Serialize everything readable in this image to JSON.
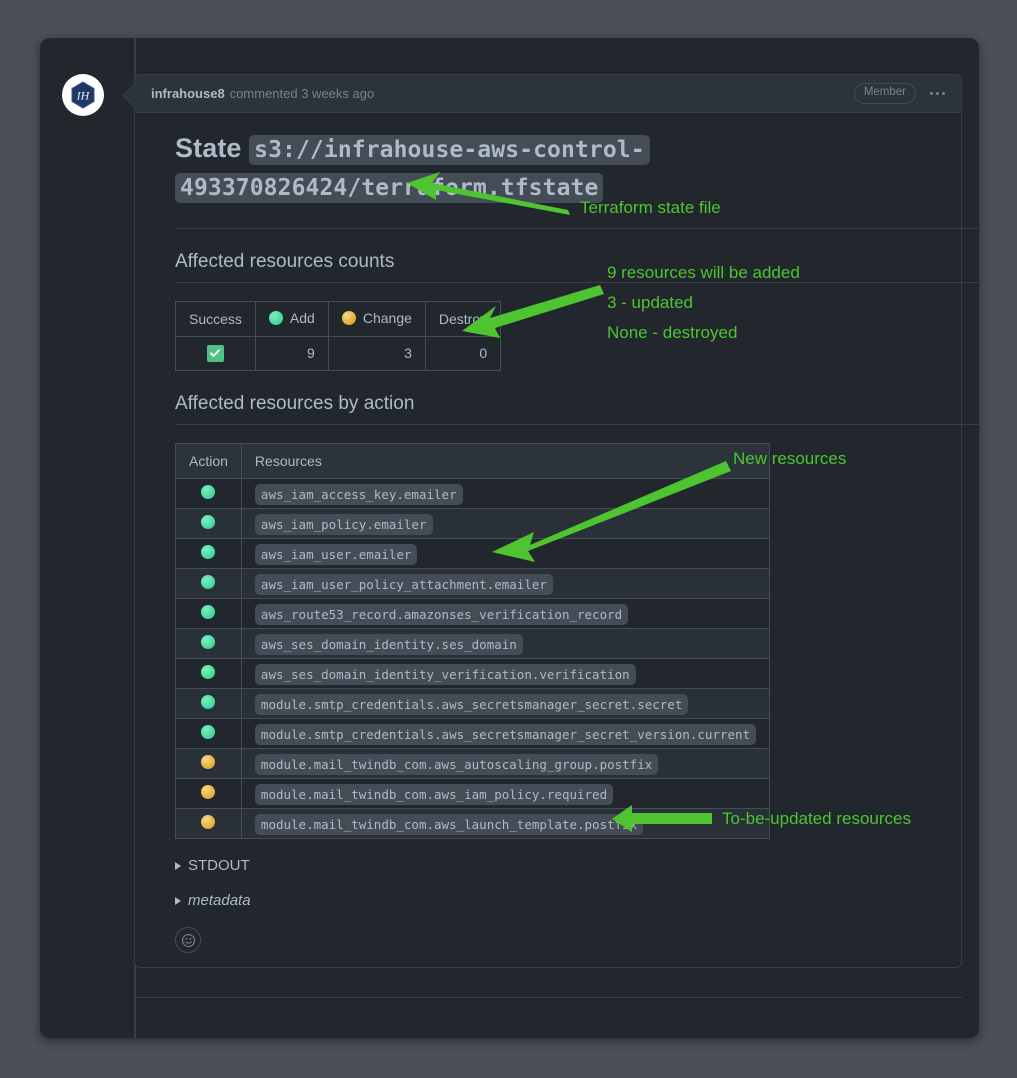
{
  "comment": {
    "author": "infrahouse8",
    "meta": "commented 3 weeks ago",
    "badge": "Member",
    "avatar_initials": "IH"
  },
  "state": {
    "label": "State",
    "path": "s3://infrahouse-aws-control-493370826424/terraform.tfstate"
  },
  "sections": {
    "counts_title": "Affected resources counts",
    "by_action_title": "Affected resources by action"
  },
  "counts_table": {
    "headers": [
      "Success",
      "Add",
      "Change",
      "Destroy"
    ],
    "row": {
      "success": true,
      "add": "9",
      "change": "3",
      "destroy": "0"
    }
  },
  "resources_table": {
    "headers": [
      "Action",
      "Resources"
    ],
    "rows": [
      {
        "action": "add",
        "name": "aws_iam_access_key.emailer"
      },
      {
        "action": "add",
        "name": "aws_iam_policy.emailer"
      },
      {
        "action": "add",
        "name": "aws_iam_user.emailer"
      },
      {
        "action": "add",
        "name": "aws_iam_user_policy_attachment.emailer"
      },
      {
        "action": "add",
        "name": "aws_route53_record.amazonses_verification_record"
      },
      {
        "action": "add",
        "name": "aws_ses_domain_identity.ses_domain"
      },
      {
        "action": "add",
        "name": "aws_ses_domain_identity_verification.verification"
      },
      {
        "action": "add",
        "name": "module.smtp_credentials.aws_secretsmanager_secret.secret"
      },
      {
        "action": "add",
        "name": "module.smtp_credentials.aws_secretsmanager_secret_version.current"
      },
      {
        "action": "change",
        "name": "module.mail_twindb_com.aws_autoscaling_group.postfix"
      },
      {
        "action": "change",
        "name": "module.mail_twindb_com.aws_iam_policy.required"
      },
      {
        "action": "change",
        "name": "module.mail_twindb_com.aws_launch_template.postfix"
      }
    ]
  },
  "disclosures": [
    {
      "label": "STDOUT",
      "italic": false
    },
    {
      "label": "metadata",
      "italic": true
    }
  ],
  "annotations": {
    "state_file": "Terraform state file",
    "counts_line1": "9 resources will be added",
    "counts_line2": "3 - updated",
    "counts_line3": "None - destroyed",
    "new_resources": "New resources",
    "updated_resources": "To-be-updated resources"
  },
  "colors": {
    "add": "#3fd699",
    "change": "#e0a92f",
    "annotation": "#4dc430",
    "success": "#4fc184"
  }
}
